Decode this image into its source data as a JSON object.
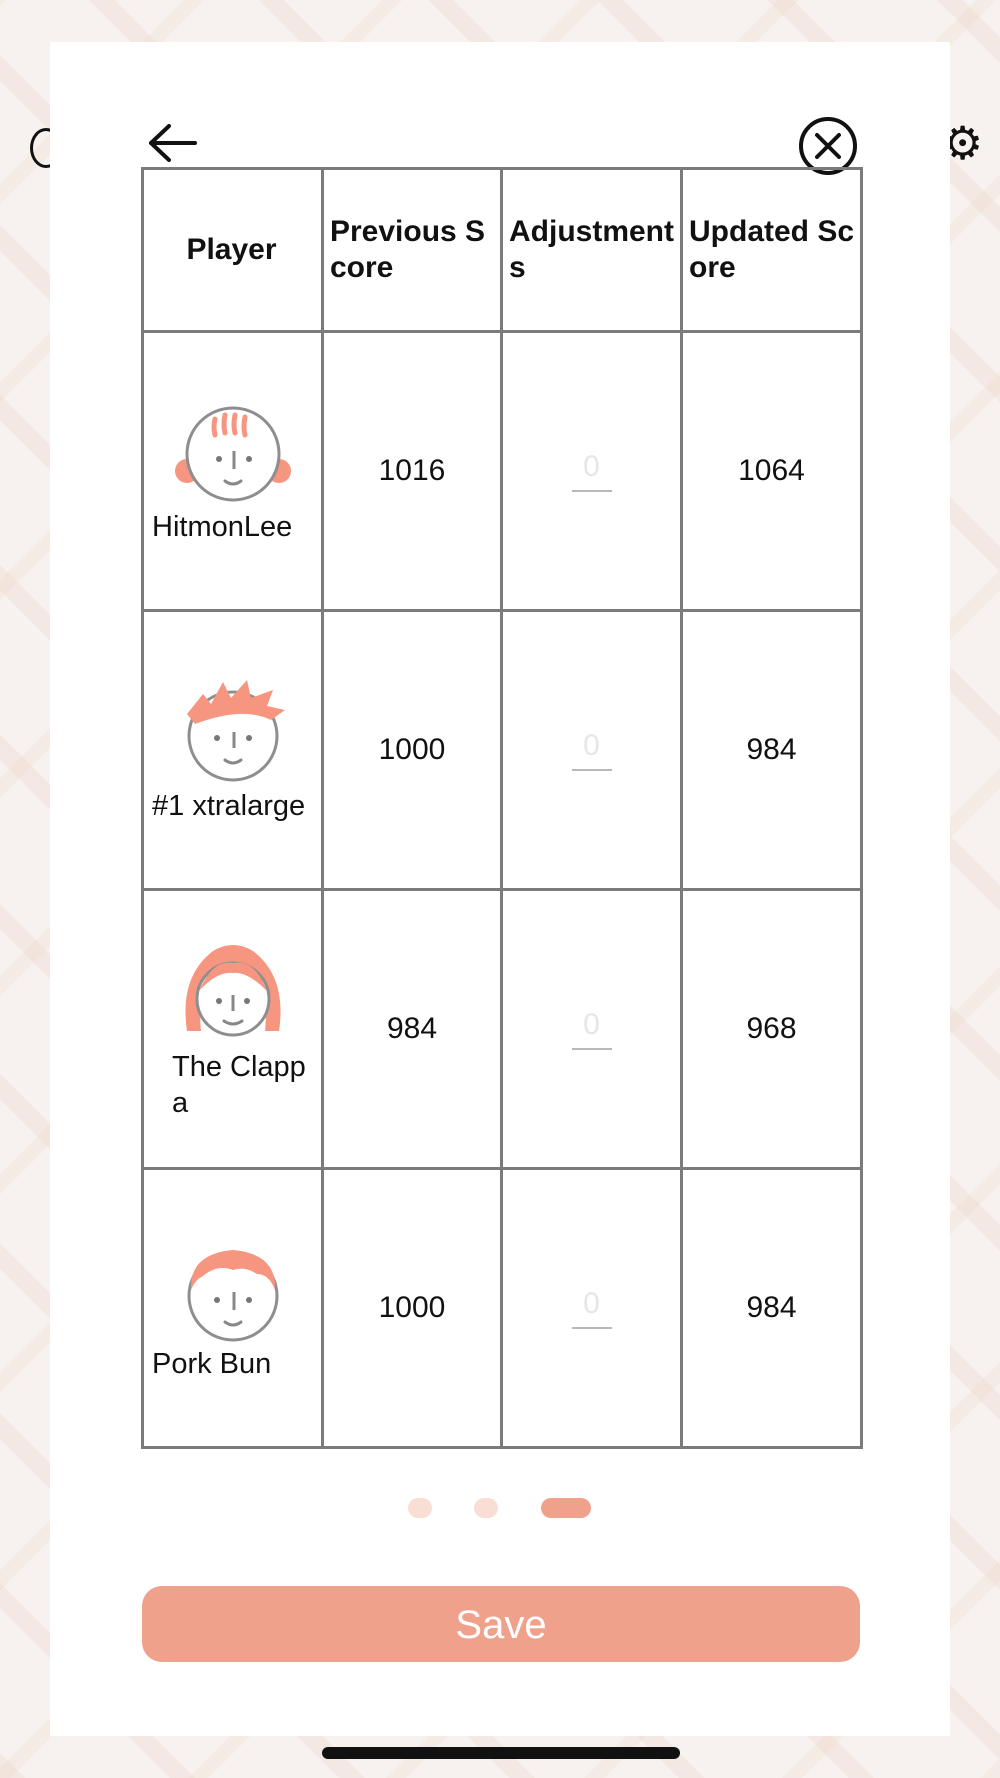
{
  "table": {
    "headers": {
      "player": "Player",
      "previous": "Previous Score",
      "adjustments": "Adjustments",
      "updated": "Updated Score"
    },
    "rows": [
      {
        "player": "HitmonLee",
        "avatar": "avatar-hair-lines-icon",
        "previous": "1016",
        "adjustment_placeholder": "0",
        "updated": "1064"
      },
      {
        "player": "#1 xtralarge",
        "avatar": "avatar-spiky-hair-icon",
        "previous": "1000",
        "adjustment_placeholder": "0",
        "updated": "984"
      },
      {
        "player": "The Clappa",
        "avatar": "avatar-long-hair-icon",
        "previous": "984",
        "adjustment_placeholder": "0",
        "updated": "968"
      },
      {
        "player": "Pork Bun",
        "avatar": "avatar-bowl-cut-icon",
        "previous": "1000",
        "adjustment_placeholder": "0",
        "updated": "984"
      }
    ]
  },
  "pagination": {
    "total": 3,
    "active_index": 2
  },
  "actions": {
    "save_label": "Save"
  },
  "colors": {
    "accent": "#f0a18c",
    "dot_inactive": "#f9ded6",
    "grid": "#7b7b7b"
  },
  "icons": {
    "back": "arrow-left-icon",
    "close": "close-circle-icon",
    "settings": "gear-icon"
  }
}
